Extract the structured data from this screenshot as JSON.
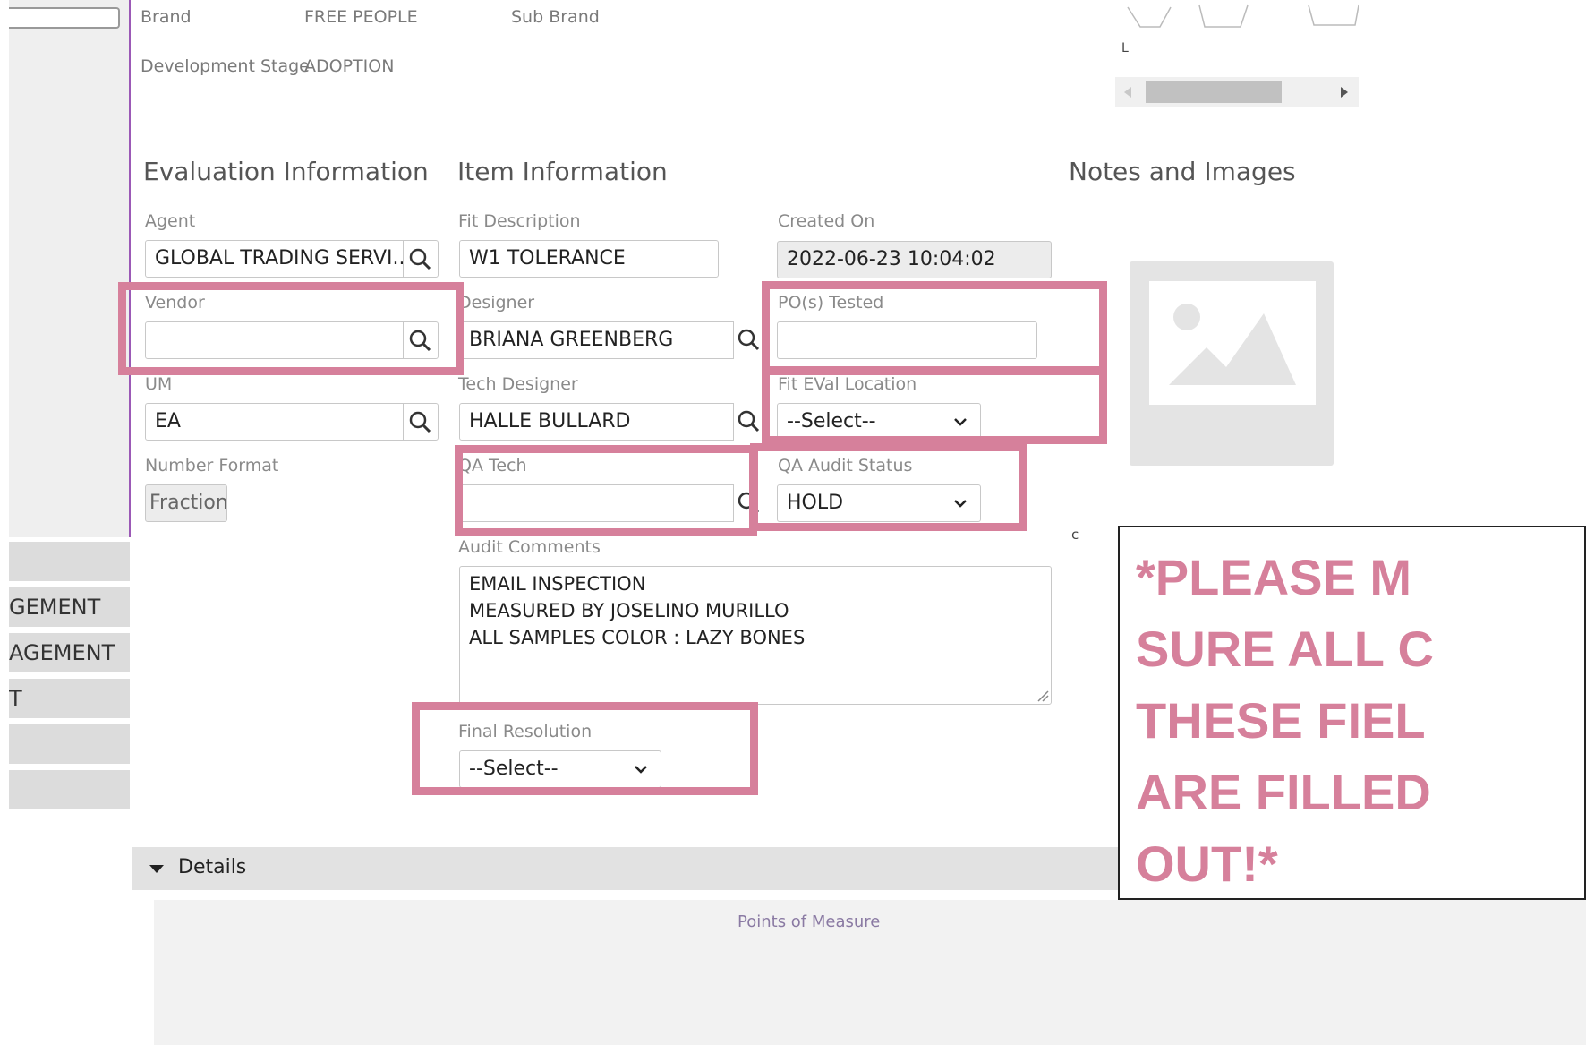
{
  "header_fields": {
    "brand_label": "Brand",
    "brand_value": "FREE PEOPLE",
    "sub_brand_label": "Sub Brand",
    "dev_stage_label": "Development Stage",
    "dev_stage_value": "ADOPTION"
  },
  "thumbnails": {
    "size_label": "L"
  },
  "sections": {
    "evaluation": "Evaluation Information",
    "item": "Item Information",
    "notes": "Notes and Images"
  },
  "evaluation": {
    "agent_label": "Agent",
    "agent_value": "GLOBAL TRADING SERVI...",
    "vendor_label": "Vendor",
    "vendor_value": "",
    "um_label": "UM",
    "um_value": "EA",
    "number_format_label": "Number Format",
    "number_format_value": "Fraction"
  },
  "item": {
    "fit_description_label": "Fit Description",
    "fit_description_value": "W1 TOLERANCE",
    "designer_label": "Designer",
    "designer_value": "BRIANA GREENBERG",
    "tech_designer_label": "Tech Designer",
    "tech_designer_value": "HALLE BULLARD",
    "qa_tech_label": "QA Tech",
    "qa_tech_value": "",
    "audit_comments_label": "Audit Comments",
    "audit_comments_lines": [
      "EMAIL INSPECTION",
      "MEASURED BY JOSELINO MURILLO",
      "ALL SAMPLES COLOR : LAZY BONES"
    ],
    "final_resolution_label": "Final Resolution",
    "final_resolution_value": "--Select--"
  },
  "meta": {
    "created_on_label": "Created On",
    "created_on_value": "2022-06-23 10:04:02",
    "pos_tested_label": "PO(s) Tested",
    "pos_tested_value": "",
    "fit_eval_location_label": "Fit EVal Location",
    "fit_eval_location_value": "--Select--",
    "qa_audit_status_label": "QA Audit Status",
    "qa_audit_status_value": "HOLD"
  },
  "notes": {
    "small_label": "c"
  },
  "sidebar": {
    "items": [
      {
        "label": ""
      },
      {
        "label": "GEMENT"
      },
      {
        "label": "AGEMENT"
      },
      {
        "label": "T"
      },
      {
        "label": ""
      },
      {
        "label": ""
      }
    ]
  },
  "callout": {
    "lines": [
      "*PLEASE M",
      "SURE ALL C",
      "THESE FIEL",
      "ARE FILLED",
      "OUT!*"
    ]
  },
  "details": {
    "toggle_label": "Details",
    "subheader": "Points of Measure"
  },
  "colors": {
    "highlight": "#d6809b",
    "accent_line": "#9b59b6"
  }
}
